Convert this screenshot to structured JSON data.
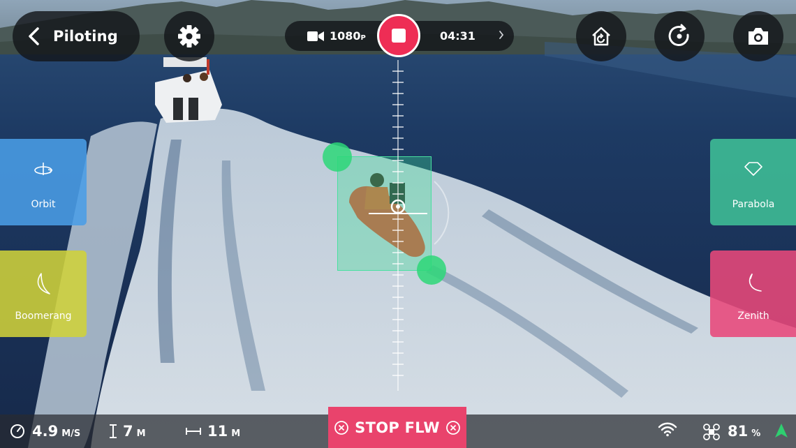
{
  "header": {
    "back_label": "Piloting"
  },
  "recording": {
    "resolution": "1080",
    "resolution_suffix": "P",
    "elapsed": "04:31"
  },
  "modes": {
    "orbit": "Orbit",
    "boomerang": "Boomerang",
    "parabola": "Parabola",
    "zenith": "Zenith"
  },
  "telemetry": {
    "speed_value": "4.9",
    "speed_unit": "M/S",
    "altitude_value": "7",
    "altitude_unit": "M",
    "distance_value": "11",
    "distance_unit": "M",
    "battery_value": "81",
    "battery_unit": "%"
  },
  "stop_follow_label": "STOP FLW",
  "colors": {
    "orbit": "#4a9de6",
    "boomerang": "#cfd23a",
    "parabola": "#3fbf96",
    "zenith": "#e8487a",
    "record": "#ee2d55",
    "stop": "#e9436c",
    "tracking": "#48e0a0",
    "gps": "#2ecf70"
  },
  "icons": [
    "chevron-left-icon",
    "gear-icon",
    "video-camera-icon",
    "record-stop-icon",
    "chevron-right-icon",
    "return-home-icon",
    "reset-orientation-icon",
    "photo-camera-icon",
    "orbit-icon",
    "boomerang-icon",
    "parabola-icon",
    "zenith-icon",
    "speed-icon",
    "altitude-icon",
    "distance-icon",
    "cancel-icon",
    "wifi-icon",
    "drone-battery-icon",
    "gps-arrow-icon"
  ]
}
